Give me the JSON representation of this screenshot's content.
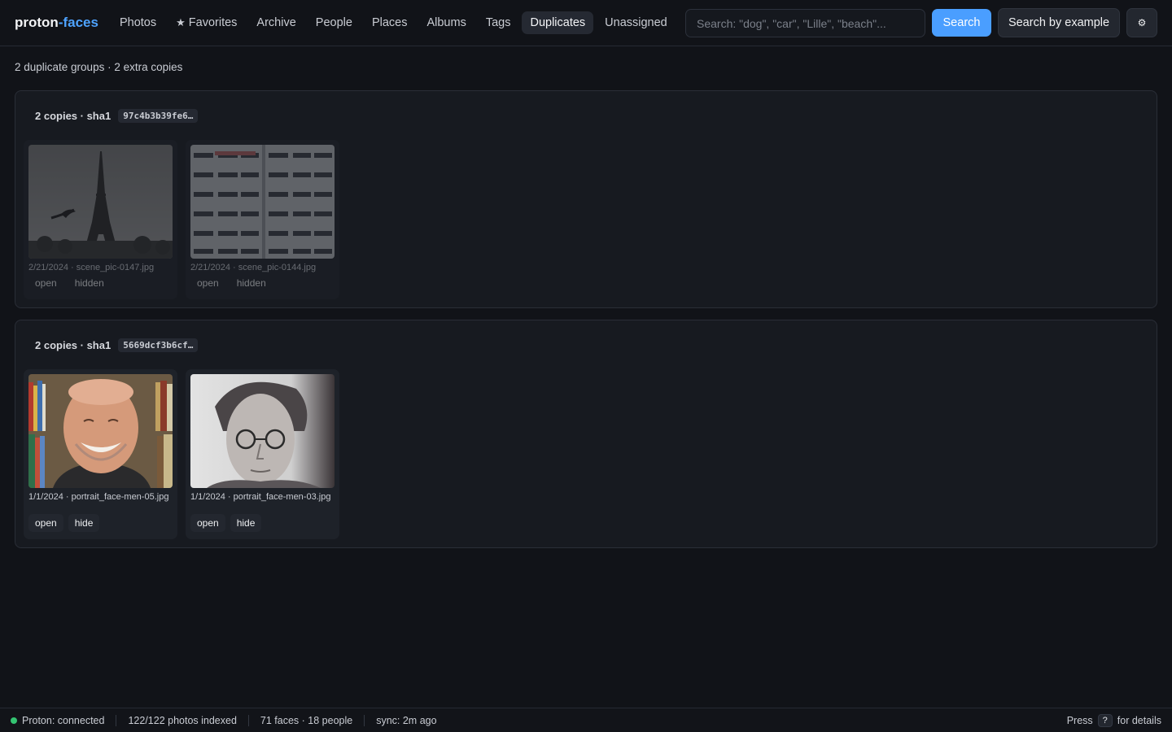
{
  "app": {
    "brand_main": "proton",
    "brand_accent": "-faces"
  },
  "nav": {
    "photos": "Photos",
    "favorites": "Favorites",
    "archive": "Archive",
    "people": "People",
    "places": "Places",
    "albums": "Albums",
    "tags": "Tags",
    "duplicates": "Duplicates",
    "unassigned": "Unassigned",
    "active": "duplicates"
  },
  "search": {
    "placeholder": "Search: \"dog\", \"car\", \"Lille\", \"beach\"...",
    "value": "",
    "button_label": "Search",
    "example_label": "Search by example",
    "settings_glyph": "⚙"
  },
  "summary": "2 duplicate groups · 2 extra copies",
  "groups": [
    {
      "title": "2 copies · sha1",
      "hash": "97c4b3b39fe6…",
      "items": [
        {
          "meta": "2/21/2024 · scene_pic-0147.jpg",
          "open_label": "open",
          "toggle_label": "hidden",
          "hidden": true,
          "image": "eiffel-tower-with-bird"
        },
        {
          "meta": "2/21/2024 · scene_pic-0144.jpg",
          "open_label": "open",
          "toggle_label": "hidden",
          "hidden": true,
          "image": "apartment-building-facade"
        }
      ]
    },
    {
      "title": "2 copies · sha1",
      "hash": "5669dcf3b6cf…",
      "items": [
        {
          "meta": "1/1/2024 · portrait_face-men-05.jpg",
          "open_label": "open",
          "toggle_label": "hide",
          "hidden": false,
          "image": "smiling-bald-man-portrait"
        },
        {
          "meta": "1/1/2024 · portrait_face-men-03.jpg",
          "open_label": "open",
          "toggle_label": "hide",
          "hidden": false,
          "image": "bw-man-with-glasses-portrait"
        }
      ]
    }
  ],
  "status": {
    "connection": "Proton: connected",
    "indexed": "122/122 photos indexed",
    "faces": "71 faces · 18 people",
    "sync": "sync: 2m ago",
    "help_prefix": "Press",
    "help_key": "?",
    "help_suffix": "for details"
  },
  "colors": {
    "accent": "#4a9eff",
    "background": "#111318",
    "status_ok": "#34c472"
  }
}
